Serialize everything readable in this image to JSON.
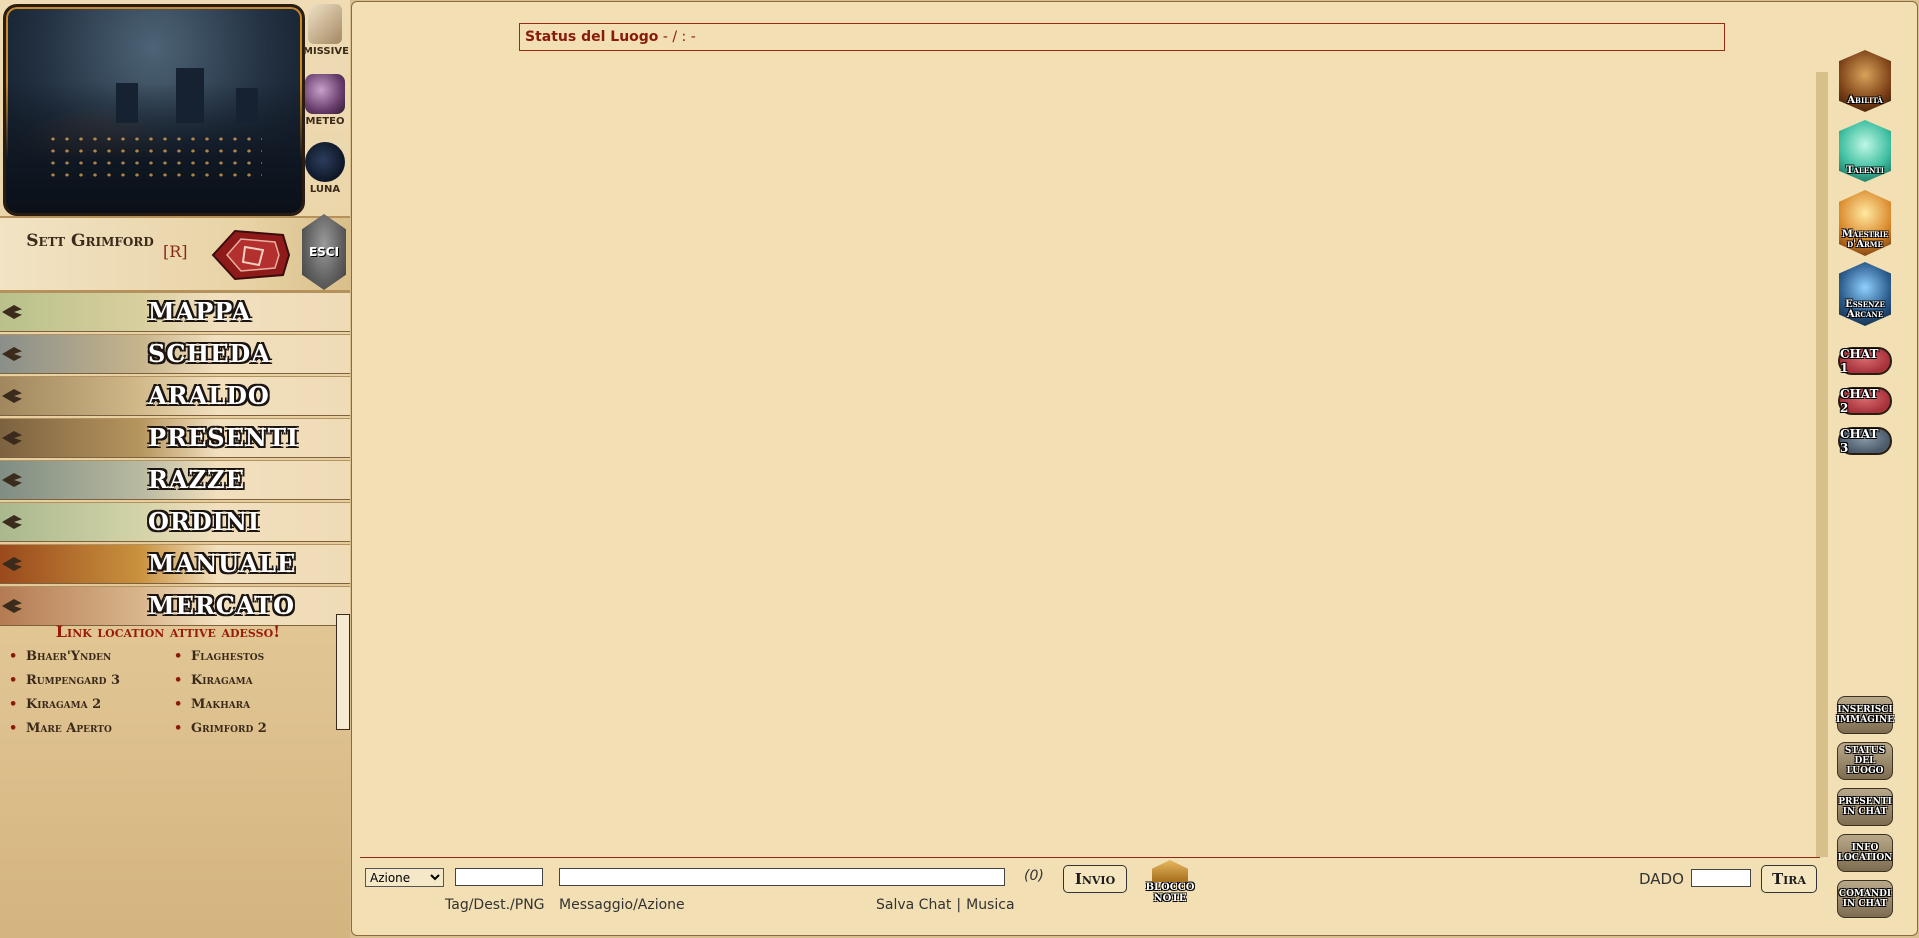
{
  "sidebar": {
    "icons": [
      {
        "label": "MISSIVE",
        "icon": "scroll-icon",
        "color": "#c9b08a"
      },
      {
        "label": "METEO",
        "icon": "weather-icon",
        "color": "#6a3f6e"
      },
      {
        "label": "LUNA",
        "icon": "moon-icon",
        "color": "#1b2a44"
      }
    ],
    "user": {
      "name": "Sett Grimford",
      "role": "[R]",
      "logout_label": "ESCI"
    },
    "nav": [
      {
        "label": "MAPPA",
        "c1": "#b9c18a",
        "c2": "#d8cf9e"
      },
      {
        "label": "SCHEDA",
        "c1": "#8a8f8a",
        "c2": "#c7b48c"
      },
      {
        "label": "ARALDO",
        "c1": "#a0875d",
        "c2": "#d1b98a"
      },
      {
        "label": "PRESENTI",
        "c1": "#7d6240",
        "c2": "#b6955e"
      },
      {
        "label": "RAZZE",
        "c1": "#7f8d83",
        "c2": "#b8b9a0"
      },
      {
        "label": "ORDINI",
        "c1": "#a9b88e",
        "c2": "#d4d3a8"
      },
      {
        "label": "MANUALE",
        "c1": "#9a4a1c",
        "c2": "#c9923e"
      },
      {
        "label": "MERCATO",
        "c1": "#b47b52",
        "c2": "#d9b58c"
      }
    ],
    "locations": {
      "title": "Link location attive adesso!",
      "items": [
        "Bhaer'Ynden",
        "Flaghestos",
        "Rumpengard 3",
        "Kiragama",
        "Kiragama 2",
        "Makhara",
        "Mare Aperto",
        "Grimford 2"
      ]
    }
  },
  "main": {
    "status": {
      "title": "Status del Luogo",
      "value": "- / : -"
    },
    "input": {
      "action_options": [
        "Azione"
      ],
      "action_selected": "Azione",
      "tag_value": "",
      "message_value": "",
      "char_count": "(0)",
      "send_label": "Invio",
      "notepad_label": "BLOCCO NOTE",
      "tag_label": "Tag/Dest./PNG",
      "message_label": "Messaggio/Azione",
      "save_chat_label": "Salva Chat",
      "separator": "|",
      "music_label": "Musica",
      "dice_label": "DADO",
      "dice_value": "",
      "roll_label": "Tira"
    }
  },
  "right_panel": {
    "badges": [
      {
        "label": "Abilità",
        "icon": "crossed-swords-icon",
        "color": "#a0602a"
      },
      {
        "label": "Talenti",
        "icon": "sparkle-icon",
        "color": "#3fbfa0"
      },
      {
        "label": "Maestrie d'Arme",
        "icon": "fire-weapon-icon",
        "color": "#d9862a"
      },
      {
        "label": "Essenze Arcane",
        "icon": "lightning-icon",
        "color": "#2a5a8a"
      }
    ],
    "chats": [
      {
        "label": "CHAT 1",
        "color": "#a8323a"
      },
      {
        "label": "CHAT 2",
        "color": "#a8323a"
      },
      {
        "label": "CHAT 3",
        "color": "#4a5a6a"
      }
    ],
    "tools": [
      {
        "label": "INSERISCI IMMAGINE",
        "icon": "insert-image-icon"
      },
      {
        "label": "STATUS DEL LUOGO",
        "icon": "status-icon"
      },
      {
        "label": "PRESENTI IN CHAT",
        "icon": "users-icon"
      },
      {
        "label": "INFO LOCATION",
        "icon": "info-icon"
      },
      {
        "label": "COMANDI IN CHAT",
        "icon": "commands-icon"
      }
    ]
  }
}
